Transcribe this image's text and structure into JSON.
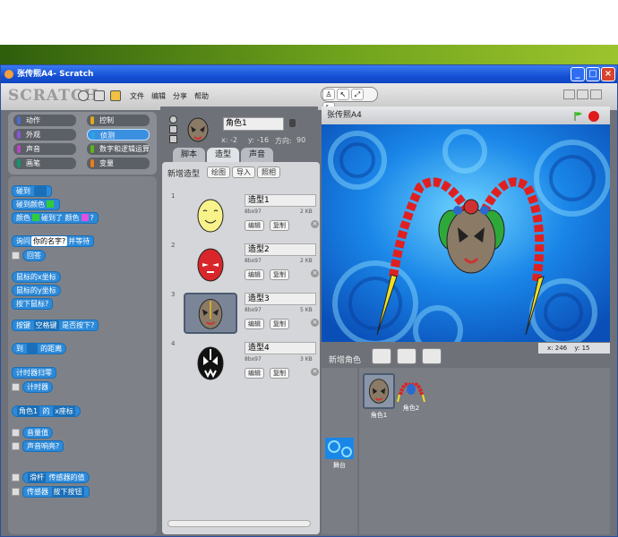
{
  "window": {
    "title": "张传熙A4- Scratch"
  },
  "menubar": {
    "logo": "SCRATCH",
    "items": [
      "文件",
      "编辑",
      "分享",
      "帮助"
    ]
  },
  "stage_tools": [
    "♙",
    "↖",
    "⤢",
    "⤡"
  ],
  "categories": [
    {
      "label": "动作",
      "color": "#4a6cd4"
    },
    {
      "label": "控制",
      "color": "#e1a91a"
    },
    {
      "label": "外观",
      "color": "#8a55d7"
    },
    {
      "label": "侦测",
      "color": "#2ca5e2"
    },
    {
      "label": "声音",
      "color": "#bb42c3"
    },
    {
      "label": "数字和逻辑运算",
      "color": "#5cb712"
    },
    {
      "label": "画笔",
      "color": "#0e9a6c"
    },
    {
      "label": "变量",
      "color": "#ee7d16"
    }
  ],
  "blocks": {
    "touching": "碰到",
    "touching_color": "碰到颜色",
    "color_touching": {
      "a": "颜色",
      "b": "碰到了 颜色",
      "c": "?"
    },
    "ask": {
      "a": "询问",
      "input": "你的名字?",
      "b": "并等待"
    },
    "answer": "回答",
    "mouse_x": "鼠标的x坐标",
    "mouse_y": "鼠标的y坐标",
    "mouse_down": "按下鼠标?",
    "key_pressed": {
      "a": "按键",
      "input": "空格键",
      "b": "是否按下?"
    },
    "distance": {
      "a": "到",
      "b": "的距离"
    },
    "reset_timer": "计时器归零",
    "timer": "计时器",
    "sensing_of": {
      "input": "角色1",
      "a": "的",
      "b": "x座标"
    },
    "loudness": "音量值",
    "loud": "声音响亮?",
    "sensor_value": {
      "input": "滑杆",
      "a": "传感器的值"
    },
    "sensor": {
      "a": "传感器",
      "input": "按下按钮"
    }
  },
  "sprite": {
    "name": "角色1",
    "x_label": "x:",
    "x": "-2",
    "y_label": "y:",
    "y": "-16",
    "dir_label": "方向:",
    "dir": "90"
  },
  "tabs": [
    "脚本",
    "造型",
    "声音"
  ],
  "costume_toolbar": {
    "label": "新增造型",
    "paint": "绘图",
    "import": "导入",
    "camera": "照相"
  },
  "costumes": [
    {
      "index": "1",
      "name": "造型1",
      "dims": "8bx97",
      "size": "2 KB",
      "edit": "编辑",
      "copy": "复制"
    },
    {
      "index": "2",
      "name": "造型2",
      "dims": "8bx97",
      "size": "2 KB",
      "edit": "编辑",
      "copy": "复制"
    },
    {
      "index": "3",
      "name": "造型3",
      "dims": "8bx97",
      "size": "5 KB",
      "edit": "编辑",
      "copy": "复制"
    },
    {
      "index": "4",
      "name": "造型4",
      "dims": "8bx97",
      "size": "3 KB",
      "edit": "编辑",
      "copy": "复制"
    }
  ],
  "stage_title": "张传熙A4",
  "mouse_coords": {
    "x_label": "x:",
    "x": "246",
    "y_label": "y:",
    "y": "15"
  },
  "new_sprite_label": "新增角色",
  "sprites": [
    "角色1",
    "角色2"
  ],
  "stage_label": "舞台",
  "colors": {
    "titlebar": "#1450d4",
    "selected_category": "#3a8fe0",
    "sensing_block": "#2d8ad9",
    "stop": "#e0191b"
  }
}
